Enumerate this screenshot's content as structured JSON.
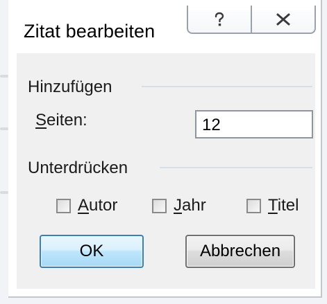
{
  "dialog": {
    "title": "Zitat bearbeiten",
    "help_button_icon": "help-icon",
    "close_button_icon": "close-icon"
  },
  "add_group": {
    "label": "Hinzufügen",
    "pages_label_first": "S",
    "pages_label_rest": "eiten:",
    "pages_value": "12"
  },
  "suppress_group": {
    "label": "Unterdrücken",
    "author": {
      "accel": "A",
      "rest": "utor",
      "checked": false
    },
    "year": {
      "accel": "J",
      "rest": "ahr",
      "checked": false
    },
    "title": {
      "accel": "T",
      "rest": "itel",
      "checked": false
    }
  },
  "buttons": {
    "ok_label": "OK",
    "cancel_label": "Abbrechen"
  },
  "colors": {
    "ok_border": "#3c7fb1",
    "group_line": "#d5dfe5",
    "panel_bg": "#f0f0f0"
  }
}
